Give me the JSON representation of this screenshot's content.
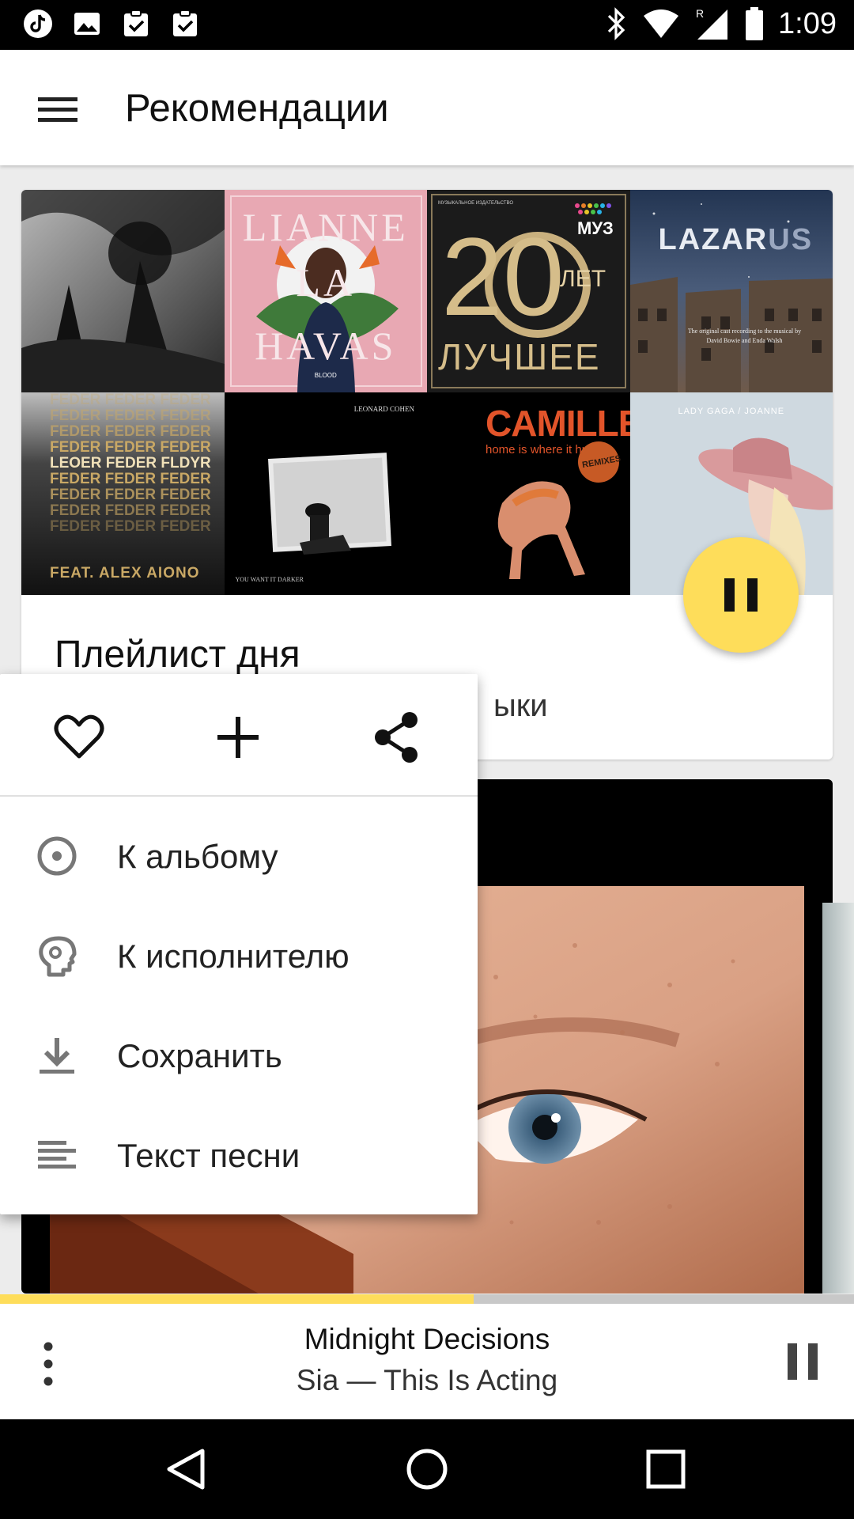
{
  "status_bar": {
    "time": "1:09",
    "icons": [
      "tiktok-icon",
      "image-icon",
      "clipboard-check-icon",
      "clipboard-check-icon",
      "bluetooth-icon",
      "wifi-icon",
      "signal-icon",
      "battery-icon"
    ]
  },
  "app_bar": {
    "title": "Рекомендации",
    "menu_icon": "menu-icon"
  },
  "playlist_card": {
    "title": "Плейлист дня",
    "subtitle_visible_tail": "ыки",
    "covers": [
      {
        "name": "dark-forest-cover"
      },
      {
        "name": "lianne-la-havas-cover",
        "text_top": "LIANNE",
        "text_mid": "LA",
        "text_bottom": "HAVAS",
        "tag": "BLOOD"
      },
      {
        "name": "muz-20-let-cover",
        "text_small": "МУЗЫКАЛЬНОЕ ИЗДАТЕЛЬСТВО",
        "badge": "МУЗ",
        "big": "20",
        "let": "ЛЕТ",
        "best": "ЛУЧШЕЕ"
      },
      {
        "name": "lazarus-cover",
        "title_a": "LAZAR",
        "title_b": "US",
        "caption_1": "The original cast recording to the musical by",
        "caption_2": "David Bowie and Enda Walsh"
      },
      {
        "name": "feder-cover",
        "line": "FEDER FEDER FEDER",
        "mid": "LEOER FEDER FLDYR",
        "feat": "FEAT. ALEX AIONO"
      },
      {
        "name": "leonard-cohen-cover",
        "artist": "LEONARD COHEN",
        "album": "YOU WANT IT DARKER"
      },
      {
        "name": "camille-cover",
        "artist": "CAMILLE",
        "album": "home is where it hurts",
        "stamp": "REMIXES"
      },
      {
        "name": "lady-gaga-joanne-cover",
        "title": "LADY GAGA / JOANNE"
      }
    ]
  },
  "fab": {
    "icon": "pause-icon"
  },
  "popup_menu": {
    "actions": [
      {
        "name": "like-button",
        "icon": "heart-icon"
      },
      {
        "name": "add-button",
        "icon": "plus-icon"
      },
      {
        "name": "share-button",
        "icon": "share-icon"
      }
    ],
    "items": [
      {
        "label": "К альбому",
        "icon": "album-icon"
      },
      {
        "label": "К исполнителю",
        "icon": "artist-icon"
      },
      {
        "label": "Сохранить",
        "icon": "download-icon"
      },
      {
        "label": "Текст песни",
        "icon": "lyrics-icon"
      }
    ]
  },
  "mini_player": {
    "track": "Midnight Decisions",
    "subtitle": "Sia — This Is Acting",
    "progress": 0.555,
    "accent": "#fedd5a"
  },
  "colors": {
    "accent": "#fedd5a",
    "status_bar": "#000000",
    "nav_bar": "#000000"
  }
}
